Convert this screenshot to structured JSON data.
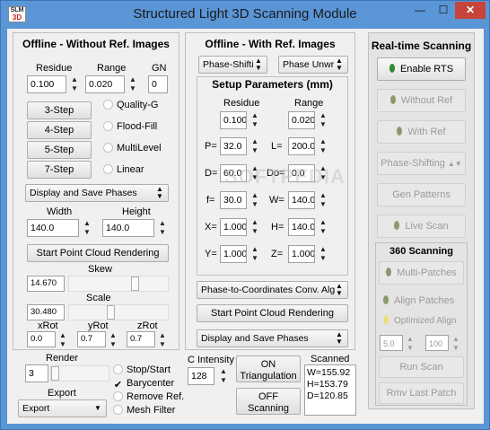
{
  "window": {
    "title": "Structured Light 3D Scanning Module",
    "app_icon_text": "SLM",
    "app_icon_accent": "3D",
    "controls": {
      "minimize": "—",
      "maximize": "☐",
      "close": "✕"
    }
  },
  "offline_no_ref": {
    "title": "Offline - Without Ref. Images",
    "residue_label": "Residue",
    "range_label": "Range",
    "gn_label": "GN",
    "residue_value": "0.100",
    "range_value": "0.020",
    "gn_value": "0",
    "step_buttons": [
      "3-Step",
      "4-Step",
      "5-Step",
      "7-Step"
    ],
    "radios": [
      "Quality-G",
      "Flood-Fill",
      "MultiLevel",
      "Linear"
    ],
    "display_select": "Display and Save Phases",
    "width_label": "Width",
    "height_label": "Height",
    "width_value": "140.0",
    "height_value": "140.0",
    "render_button": "Start Point Cloud Rendering",
    "skew_label": "Skew",
    "skew_value": "14.670",
    "skew_level": 0.68,
    "scale_label": "Scale",
    "scale_value": "30.480",
    "scale_level": 0.42,
    "xrot_label": "xRot",
    "yrot_label": "yRot",
    "zrot_label": "zRot",
    "xrot_value": "0.0",
    "yrot_value": "0.7",
    "zrot_value": "0.7"
  },
  "render": {
    "label": "Render",
    "value": "3",
    "export_label": "Export",
    "export_select": "Export",
    "options": [
      {
        "label": "Stop/Start",
        "checked": false,
        "mark": ""
      },
      {
        "label": "Barycenter",
        "checked": true,
        "mark": "✔"
      },
      {
        "label": "Remove Ref.",
        "checked": false,
        "mark": ""
      },
      {
        "label": "Mesh Filter",
        "checked": false,
        "mark": ""
      }
    ]
  },
  "offline_with_ref": {
    "title": "Offline - With Ref. Images",
    "phase_select_1": "Phase-Shifti",
    "phase_select_2": "Phase Unwr",
    "setup_title": "Setup Parameters (mm)",
    "residue_label": "Residue",
    "range_label": "Range",
    "residue_value": "0.100",
    "range_value": "0.020",
    "params": [
      {
        "label": "P=",
        "value": "32.0"
      },
      {
        "label": "L=",
        "value": "200.0"
      },
      {
        "label": "D=",
        "value": "60.0"
      },
      {
        "label": "Do=",
        "value": "0.0"
      },
      {
        "label": "f=",
        "value": "30.0"
      },
      {
        "label": "W=",
        "value": "140.0"
      },
      {
        "label": "X=",
        "value": "1.000"
      },
      {
        "label": "H=",
        "value": "140.0"
      },
      {
        "label": "Y=",
        "value": "1.000"
      },
      {
        "label": "Z=",
        "value": "1.000"
      }
    ],
    "conv_select": "Phase-to-Coordinates Conv. Alg",
    "render_button": "Start Point Cloud Rendering",
    "display_select": "Display and Save Phases"
  },
  "capture": {
    "intensity_label": "C Intensity",
    "intensity_value": "128",
    "triangulation_button": "ON\nTriangulation",
    "scanning_button": "OFF\nScanning",
    "scanned_label": "Scanned",
    "scanned_lines": [
      "W=155.92",
      "H=153.79",
      "D=120.85"
    ]
  },
  "realtime": {
    "title": "Real-time Scanning",
    "enable_rts": "Enable RTS",
    "without_ref": "Without Ref",
    "with_ref": "With Ref",
    "phase_shifting": "Phase-Shifting",
    "gen_patterns": "Gen Patterns",
    "live_scan": "Live Scan",
    "scan360_title": "360 Scanning",
    "multi_patches": "Multi-Patches",
    "align_patches": "Align Patches",
    "optimized_align": "Optimized Align",
    "val_a": "5.0",
    "val_b": "100",
    "run_scan": "Run Scan",
    "rmv_last_patch": "Rmv Last Patch"
  },
  "watermark": "SOFTPEDIA",
  "colors": {
    "titlebar": "#5a95d6",
    "close": "#c7443a",
    "led_active": "#2e8b2e",
    "led_inactive": "#8a9a6a",
    "led_yellow": "#e8e07a"
  }
}
